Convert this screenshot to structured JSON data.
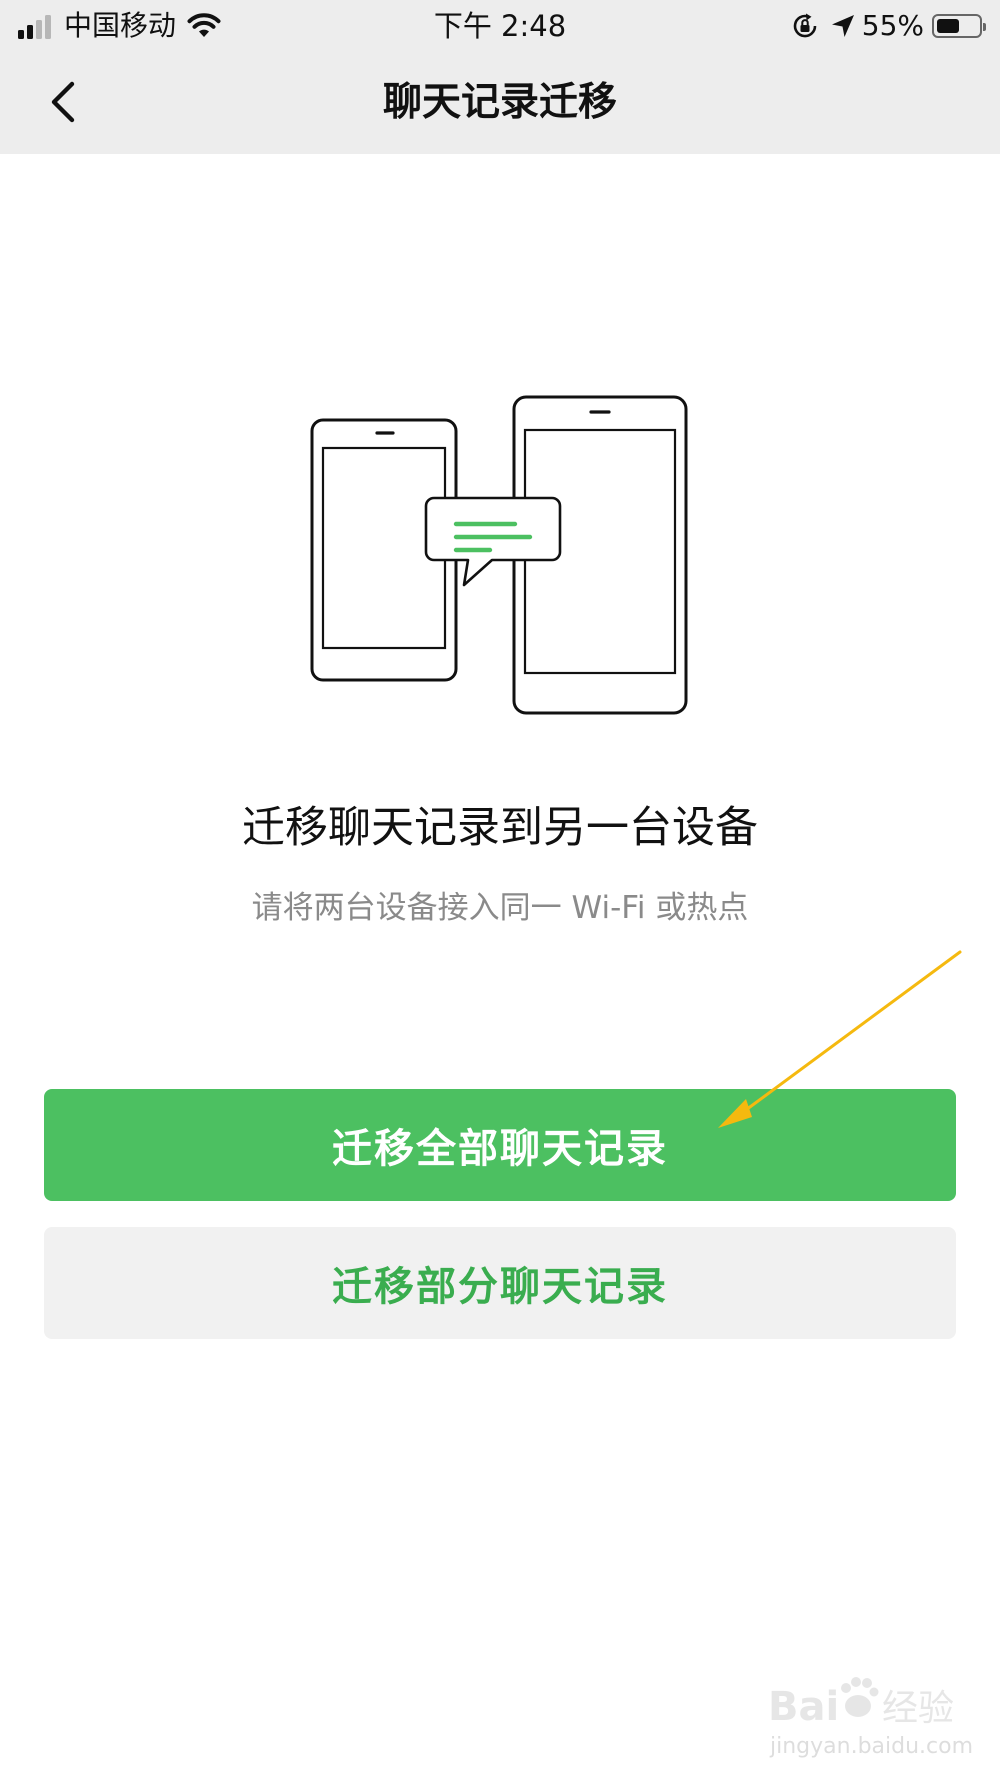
{
  "status_bar": {
    "carrier": "中国移动",
    "time": "下午 2:48",
    "battery_percent_label": "55%",
    "battery_level": 0.55,
    "signal_bars_active": 2,
    "signal_bars_total": 4,
    "icons": [
      "cellular-signal-icon",
      "wifi-icon",
      "rotation-lock-icon",
      "location-arrow-icon",
      "battery-icon"
    ]
  },
  "nav": {
    "title": "聊天记录迁移",
    "back_icon": "chevron-left-icon"
  },
  "illustration": {
    "icons": [
      "small-phone-icon",
      "large-phone-icon",
      "chat-bubble-icon"
    ],
    "accent_color": "#4cc061"
  },
  "content": {
    "headline": "迁移聊天记录到另一台设备",
    "hint": "请将两台设备接入同一 Wi-Fi 或热点"
  },
  "actions": {
    "migrate_all_label": "迁移全部聊天记录",
    "migrate_partial_label": "迁移部分聊天记录"
  },
  "annotation": {
    "arrow_color": "#f5b90f"
  },
  "watermark": {
    "logo_text": "Baidu经验",
    "url": "jingyan.baidu.com"
  },
  "colors": {
    "primary_green": "#4cc061",
    "secondary_button_bg": "#f1f1f1",
    "secondary_button_text": "#3aad4f",
    "navbar_bg": "#ededed",
    "hint_gray": "#8a8a8a"
  }
}
